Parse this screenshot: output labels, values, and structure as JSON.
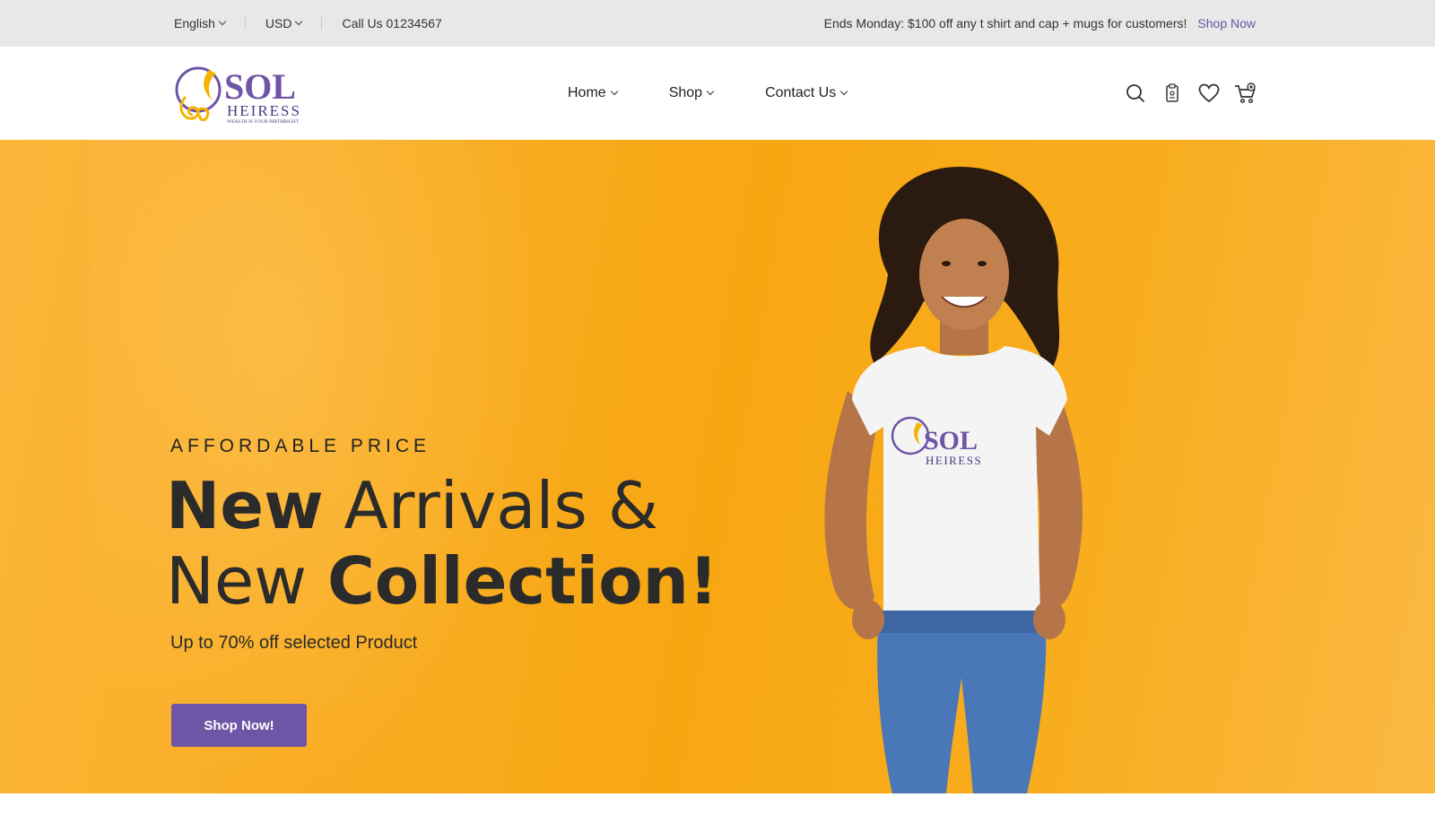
{
  "topbar": {
    "language": "English",
    "currency": "USD",
    "phone": "Call Us 01234567",
    "promo_text": "Ends Monday: $100 off any t shirt and cap + mugs for customers!",
    "promo_link": "Shop Now"
  },
  "brand": {
    "name": "SOL",
    "sub": "HEIRESS",
    "tagline": "WEALTH IS YOUR BIRTHRIGHT",
    "colors": {
      "purple": "#6e55a6",
      "gold": "#f5b300"
    }
  },
  "nav": {
    "items": [
      {
        "label": "Home"
      },
      {
        "label": "Shop"
      },
      {
        "label": "Contact Us"
      }
    ]
  },
  "header_icons": [
    "search-icon",
    "compare-icon",
    "wishlist-heart-icon",
    "cart-icon"
  ],
  "hero": {
    "eyebrow": "AFFORDABLE PRICE",
    "line1_bold": "New",
    "line1_rest": " Arrivals &",
    "line2_start": "New ",
    "line2_bold": "Collection!",
    "subtitle": "Up to 70% off selected Product",
    "cta": "Shop Now!",
    "bg_color": "#f7a712"
  }
}
